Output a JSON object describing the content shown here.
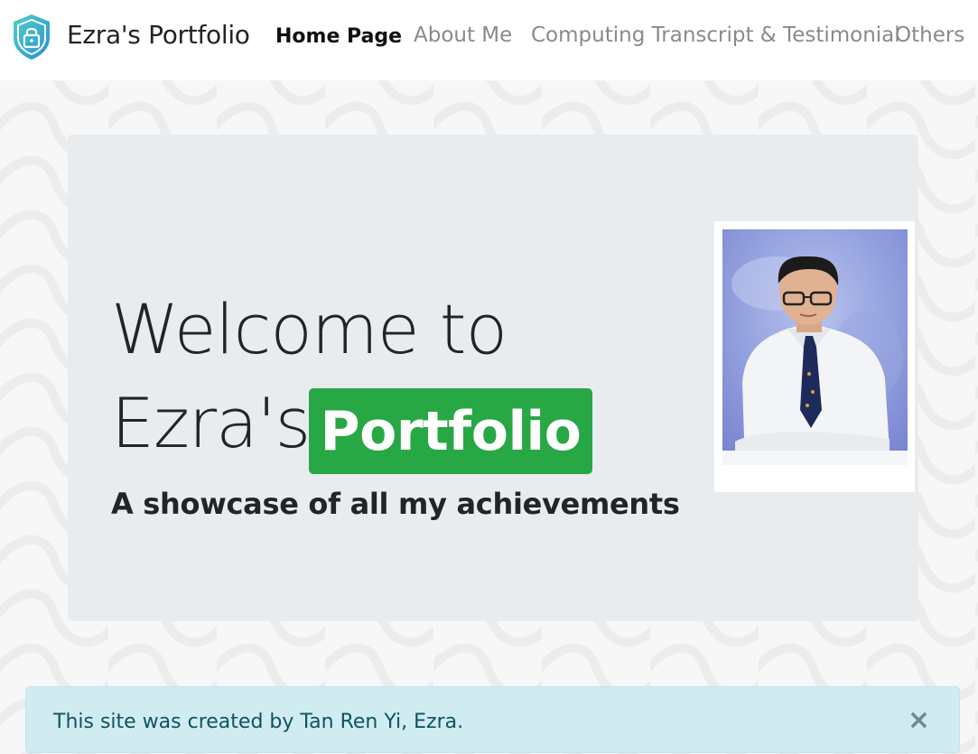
{
  "navbar": {
    "brand": "Ezra's Portfolio",
    "logo_icon": "shield-lock-icon",
    "links": [
      {
        "label": "Home Page",
        "active": true
      },
      {
        "label": "About Me",
        "active": false
      },
      {
        "label": "Computing Transcript & Testimonial",
        "active": false
      },
      {
        "label": "Others",
        "active": false
      }
    ]
  },
  "hero": {
    "line1": "Welcome to",
    "line2": "Ezra's",
    "badge": "Portfolio",
    "tagline": "A showcase of all my achievements",
    "badge_color": "#28a745"
  },
  "alert": {
    "text": "This site was created by Tan Ren Yi, Ezra.",
    "close_symbol": "×",
    "close_icon": "close-icon"
  },
  "colors": {
    "jumbotron_bg": "#e9ecef",
    "alert_bg": "#d1ecf1",
    "alert_text": "#0c5460"
  }
}
